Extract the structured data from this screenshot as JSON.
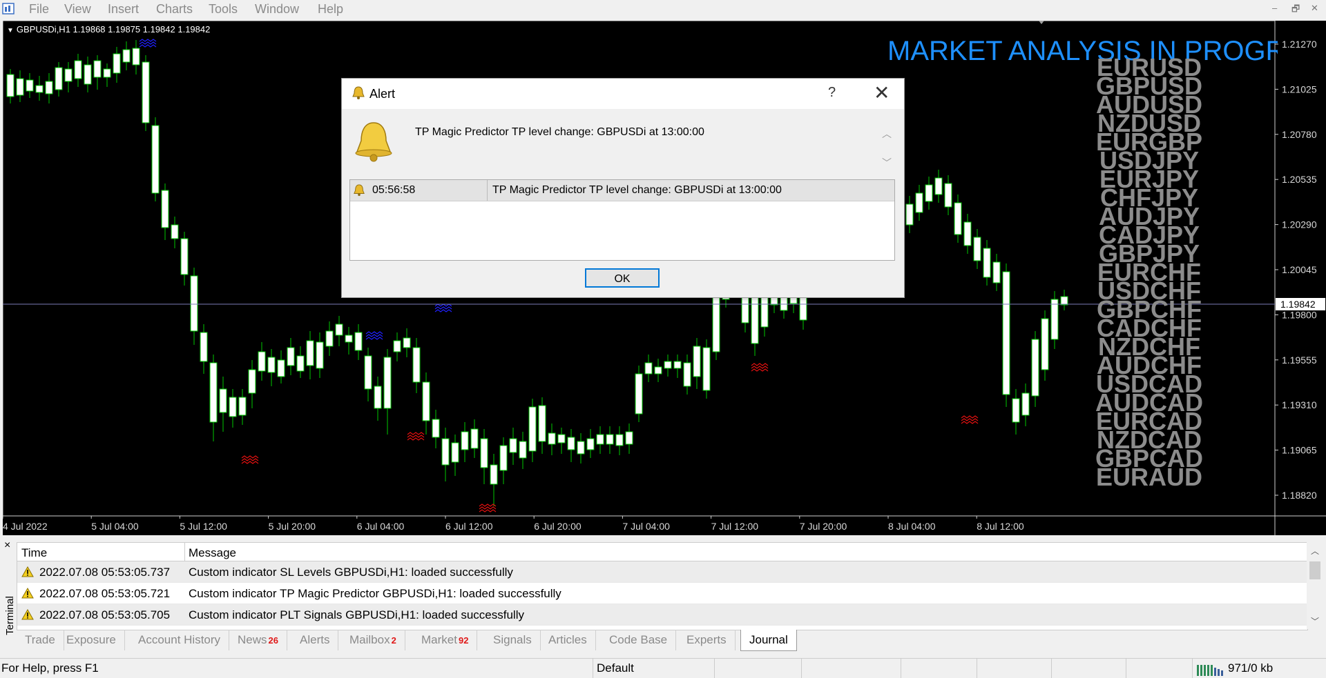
{
  "menu": {
    "items": [
      "File",
      "View",
      "Insert",
      "Charts",
      "Tools",
      "Window",
      "Help"
    ],
    "window_controls": [
      "–",
      "🗗",
      "✕"
    ]
  },
  "chart": {
    "symbol_line": "GBPUSDi,H1  1.19868 1.19875 1.19842 1.19842",
    "banner": "MARKET ANALYSIS IN PROGRESS",
    "pairs": [
      "EURUSD",
      "GBPUSD",
      "AUDUSD",
      "NZDUSD",
      "EURGBP",
      "USDJPY",
      "EURJPY",
      "CHFJPY",
      "AUDJPY",
      "CADJPY",
      "GBPJPY",
      "EURCHF",
      "USDCHF",
      "GBPCHF",
      "CADCHF",
      "NZDCHF",
      "AUDCHF",
      "USDCAD",
      "AUDCAD",
      "EURCAD",
      "NZDCAD",
      "GBPCAD",
      "EURAUD"
    ],
    "price_labels": [
      "1.21270",
      "1.21025",
      "1.20780",
      "1.20535",
      "1.20290",
      "1.20045",
      "1.19800",
      "1.19555",
      "1.19310",
      "1.19065",
      "1.18820"
    ],
    "current_price": "1.19842",
    "time_labels": [
      "4 Jul 2022",
      "5 Jul 04:00",
      "5 Jul 12:00",
      "5 Jul 20:00",
      "6 Jul 04:00",
      "6 Jul 12:00",
      "6 Jul 20:00",
      "7 Jul 04:00",
      "7 Jul 12:00",
      "7 Jul 20:00",
      "8 Jul 04:00",
      "8 Jul 12:00"
    ],
    "colors": {
      "bull": "#ffffff",
      "wick": "#00c800",
      "bg": "#000000",
      "banner": "#1e90ff",
      "pairs": "#8c8c8c",
      "mark_high": "#2020ff",
      "mark_low": "#e01010"
    }
  },
  "alert": {
    "title": "Alert",
    "help": "?",
    "close": "✕",
    "message": "TP Magic Predictor TP level change: GBPUSDi at 13:00:00",
    "history": [
      {
        "time": "05:56:58",
        "message": "TP Magic Predictor TP level change: GBPUSDi at 13:00:00"
      }
    ],
    "ok_label": "OK"
  },
  "terminal": {
    "side_label": "Terminal",
    "close": "×",
    "headers": {
      "time": "Time",
      "message": "Message"
    },
    "rows": [
      {
        "time": "2022.07.08 05:53:05.737",
        "message": "Custom indicator SL Levels GBPUSDi,H1: loaded successfully"
      },
      {
        "time": "2022.07.08 05:53:05.721",
        "message": "Custom indicator TP Magic Predictor GBPUSDi,H1: loaded successfully"
      },
      {
        "time": "2022.07.08 05:53:05.705",
        "message": "Custom indicator PLT Signals GBPUSDi,H1: loaded successfully"
      }
    ],
    "tabs": [
      {
        "label": "Trade"
      },
      {
        "label": "Exposure"
      },
      {
        "label": "Account History"
      },
      {
        "label": "News",
        "badge": "26"
      },
      {
        "label": "Alerts"
      },
      {
        "label": "Mailbox",
        "badge": "2"
      },
      {
        "label": "Market",
        "badge": "92"
      },
      {
        "label": "Signals"
      },
      {
        "label": "Articles"
      },
      {
        "label": "Code Base"
      },
      {
        "label": "Experts"
      },
      {
        "label": "Journal",
        "active": true
      }
    ]
  },
  "status": {
    "help": "For Help, press F1",
    "profile": "Default",
    "traffic": "971/0 kb"
  }
}
